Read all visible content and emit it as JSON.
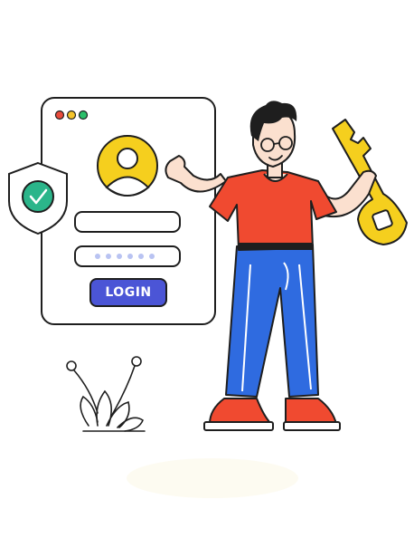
{
  "login": {
    "button_label": "LOGIN"
  },
  "icons": {
    "window_dots": [
      "window-dot-red-icon",
      "window-dot-yellow-icon",
      "window-dot-green-icon"
    ],
    "avatar": "user-avatar-icon",
    "shield": "shield-check-icon",
    "key": "key-icon",
    "plant": "plant-icon"
  },
  "colors": {
    "dot_red": "#e94b3c",
    "dot_yellow": "#f5c52b",
    "dot_green": "#2bbf6a",
    "avatar_fill": "#f5cf1e",
    "shield_badge": "#2bb58a",
    "button": "#4b55d6",
    "field_line": "#b9c3f2",
    "shirt": "#f04a30",
    "pants": "#2f6be0",
    "shoes": "#f04a30",
    "key": "#f5cf1e",
    "outline": "#1e1e1e"
  },
  "password_mask_count": 6
}
